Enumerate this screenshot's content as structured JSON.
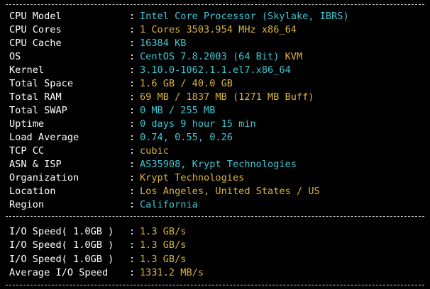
{
  "colors": {
    "background": "#000000",
    "label": "#ffffff",
    "cyan": "#3fc7d4",
    "yellow": "#d9b43c",
    "divider": "#d8d8d8"
  },
  "system_info": [
    {
      "label": "CPU Model",
      "value": "Intel Core Processor (Skylake, IBRS)",
      "color": "cyan"
    },
    {
      "label": "CPU Cores",
      "value": "1 Cores 3503.954 MHz x86_64",
      "color": "yellow"
    },
    {
      "label": "CPU Cache",
      "value": "16384 KB",
      "color": "cyan"
    },
    {
      "label": "OS",
      "value": "CentOS 7.8.2003 (64 Bit)",
      "value_extra": "KVM",
      "color": "cyan",
      "extra_color": "yellow"
    },
    {
      "label": "Kernel",
      "value": "3.10.0-1062.1.1.el7.x86_64",
      "color": "cyan"
    },
    {
      "label": "Total Space",
      "value": "1.6 GB / 40.0 GB",
      "color": "yellow"
    },
    {
      "label": "Total RAM",
      "value": "69 MB / 1837 MB (1271 MB Buff)",
      "color": "yellow"
    },
    {
      "label": "Total SWAP",
      "value": "0 MB / 255 MB",
      "color": "cyan"
    },
    {
      "label": "Uptime",
      "value": "0 days 9 hour 15 min",
      "color": "cyan"
    },
    {
      "label": "Load Average",
      "value": "0.74, 0.55, 0.26",
      "color": "cyan"
    },
    {
      "label": "TCP CC",
      "value": "cubic",
      "color": "yellow"
    },
    {
      "label": "ASN & ISP",
      "value": "AS35908, Krypt Technologies",
      "color": "cyan"
    },
    {
      "label": "Organization",
      "value": "Krypt Technologies",
      "color": "yellow"
    },
    {
      "label": "Location",
      "value": "Los Angeles, United States / US",
      "color": "yellow"
    },
    {
      "label": "Region",
      "value": "California",
      "color": "cyan"
    }
  ],
  "io_info": [
    {
      "label": "I/O Speed( 1.0GB )",
      "value": "1.3 GB/s",
      "color": "yellow"
    },
    {
      "label": "I/O Speed( 1.0GB )",
      "value": "1.3 GB/s",
      "color": "yellow"
    },
    {
      "label": "I/O Speed( 1.0GB )",
      "value": "1.3 GB/s",
      "color": "yellow"
    },
    {
      "label": "Average I/O Speed",
      "value": "1331.2 MB/s",
      "color": "yellow"
    }
  ],
  "separator": ":"
}
